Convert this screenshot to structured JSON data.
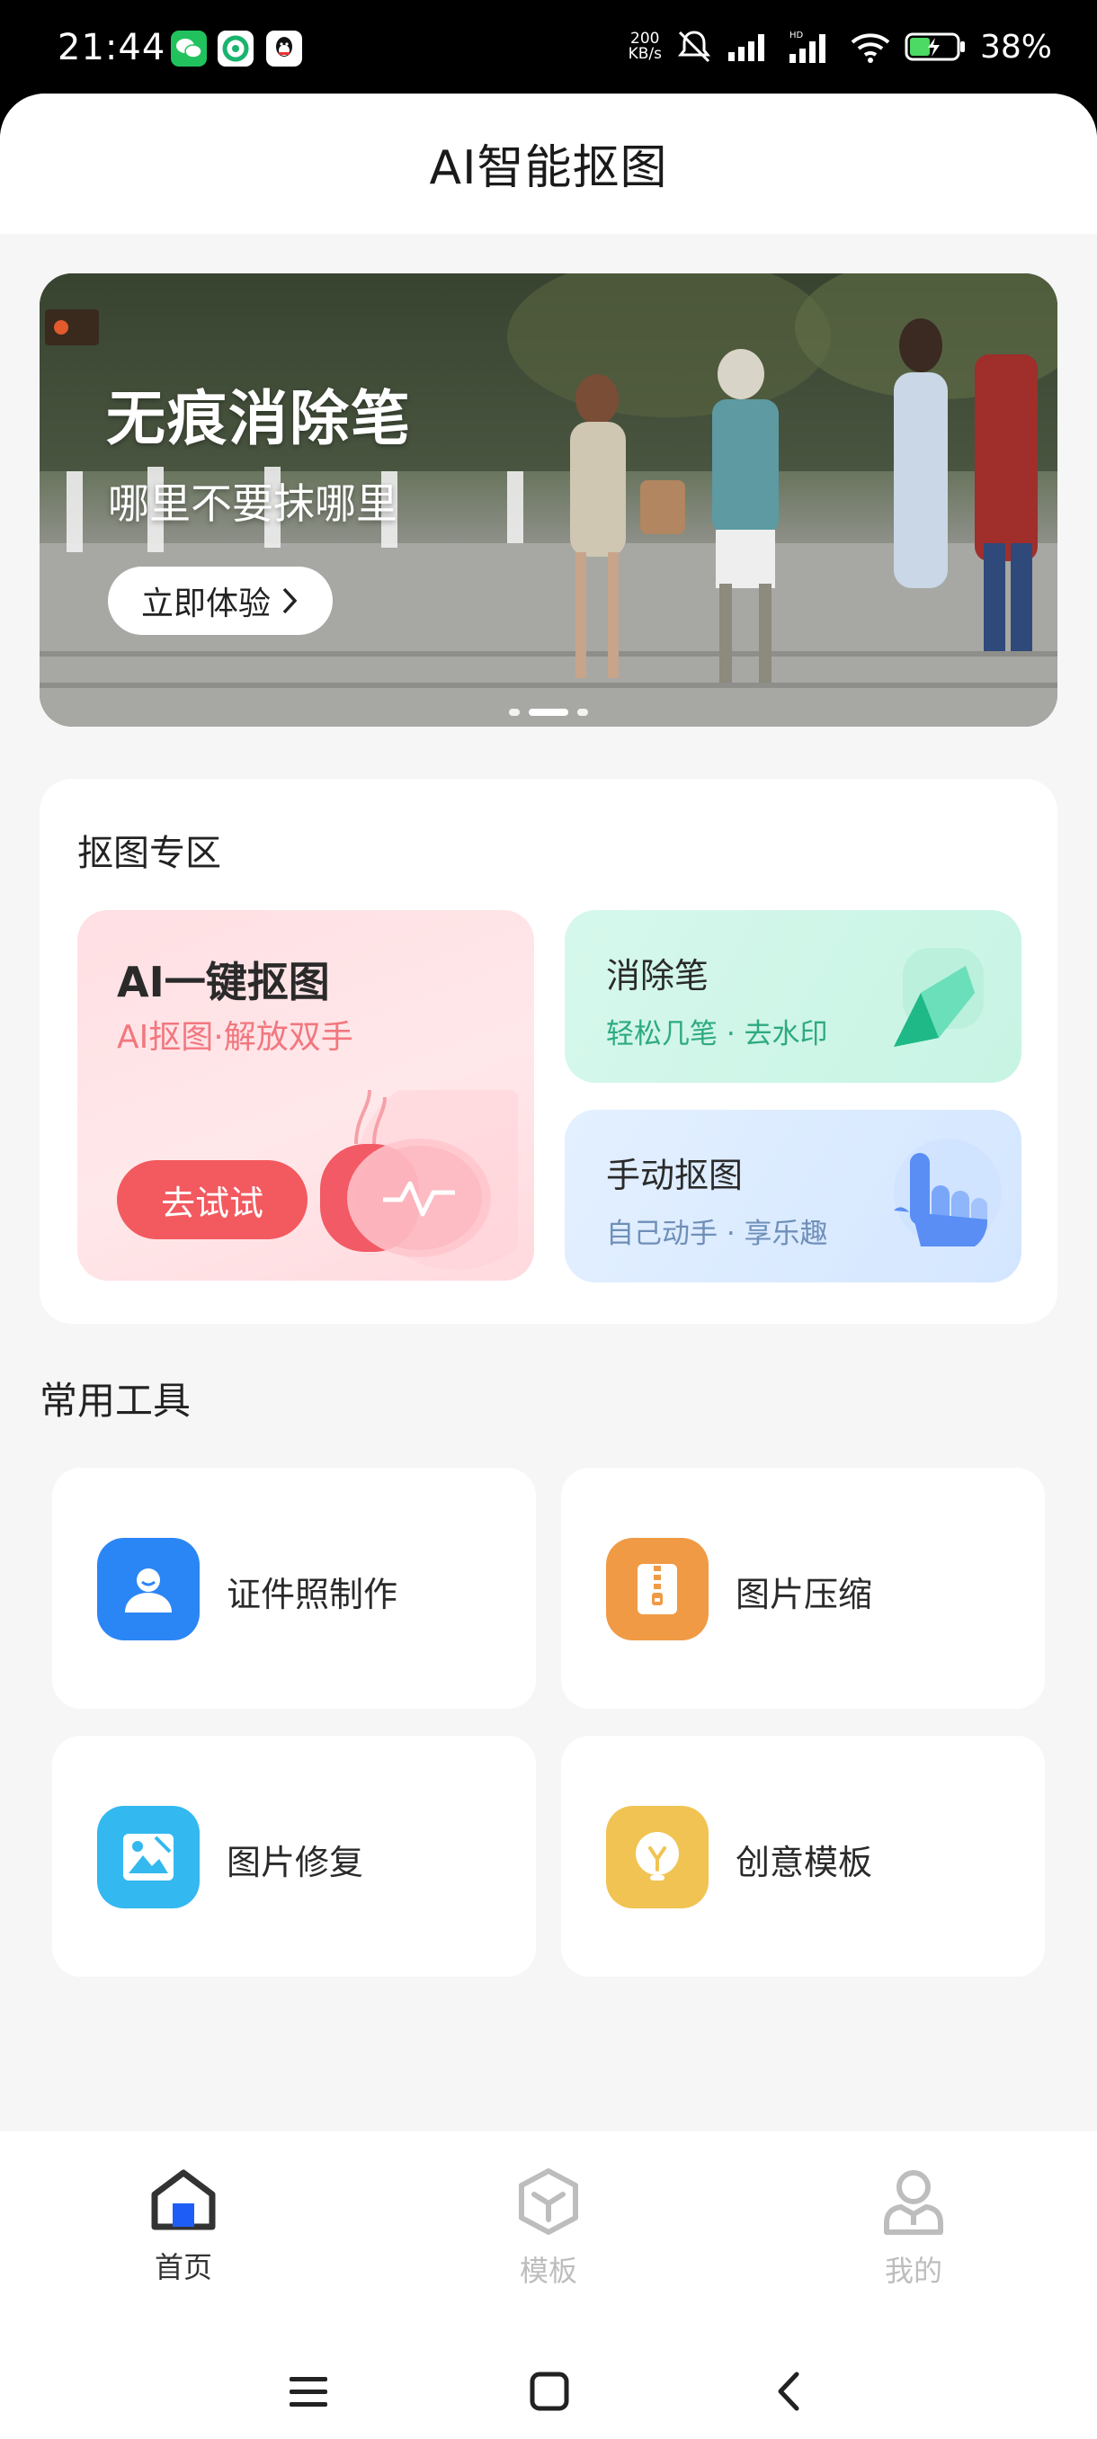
{
  "status_bar": {
    "time": "21:44",
    "net_speed_value": "200",
    "net_speed_unit": "KB/s",
    "battery": "38%",
    "app_icons": [
      "wechat-icon",
      "green-app-icon",
      "qq-icon"
    ]
  },
  "header": {
    "title": "AI智能抠图"
  },
  "banner": {
    "title": "无痕消除笔",
    "subtitle": "哪里不要抹哪里",
    "button": "立即体验",
    "slide_count": 3,
    "active_slide": 2
  },
  "cutout_zone": {
    "title": "抠图专区",
    "ai_card": {
      "title": "AI一键抠图",
      "subtitle": "AI抠图·解放双手",
      "button": "去试试"
    },
    "erase_card": {
      "title": "消除笔",
      "subtitle": "轻松几笔 · 去水印"
    },
    "manual_card": {
      "title": "手动抠图",
      "subtitle": "自己动手 · 享乐趣"
    }
  },
  "tools": {
    "title": "常用工具",
    "items": [
      {
        "label": "证件照制作",
        "icon": "person-icon",
        "color": "#2b86f5"
      },
      {
        "label": "图片压缩",
        "icon": "zip-icon",
        "color": "#f09a45"
      },
      {
        "label": "图片修复",
        "icon": "image-icon",
        "color": "#33b8ef"
      },
      {
        "label": "创意模板",
        "icon": "bulb-icon",
        "color": "#f1c352"
      }
    ]
  },
  "bottom_nav": {
    "items": [
      {
        "label": "首页",
        "icon": "home-icon",
        "active": true
      },
      {
        "label": "模板",
        "icon": "cube-icon",
        "active": false
      },
      {
        "label": "我的",
        "icon": "user-icon",
        "active": false
      }
    ]
  },
  "colors": {
    "accent": "#1e5ef7",
    "nav_active": "#333333",
    "nav_inactive": "#bdbdbd",
    "try_button": "#f25a5f"
  }
}
